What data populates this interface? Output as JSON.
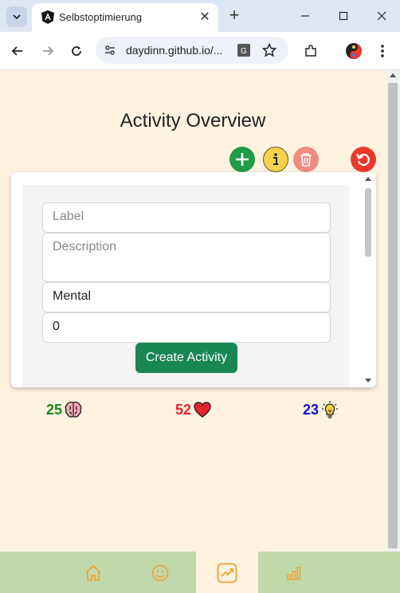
{
  "browser": {
    "tab_title": "Selbstoptimierung",
    "url": "daydinn.github.io/..."
  },
  "page": {
    "title": "Activity Overview"
  },
  "form": {
    "label_placeholder": "Label",
    "description_placeholder": "Description",
    "category_value": "Mental",
    "points_value": "0",
    "create_button": "Create Activity"
  },
  "stats": {
    "mental": "25",
    "physical": "52",
    "idea": "23"
  },
  "colors": {
    "page_bg": "#fff3e0",
    "nav_bg": "#c1d8aa",
    "accent": "#f0a030",
    "mental": "#1a8a1a",
    "physical": "#e8242c",
    "idea": "#1010d8"
  },
  "icons": {
    "add": "plus-icon",
    "info": "info-icon",
    "delete": "trash-icon",
    "reset": "reset-icon",
    "nav": [
      "home-icon",
      "smiley-icon",
      "trend-icon",
      "bar-chart-icon"
    ]
  }
}
